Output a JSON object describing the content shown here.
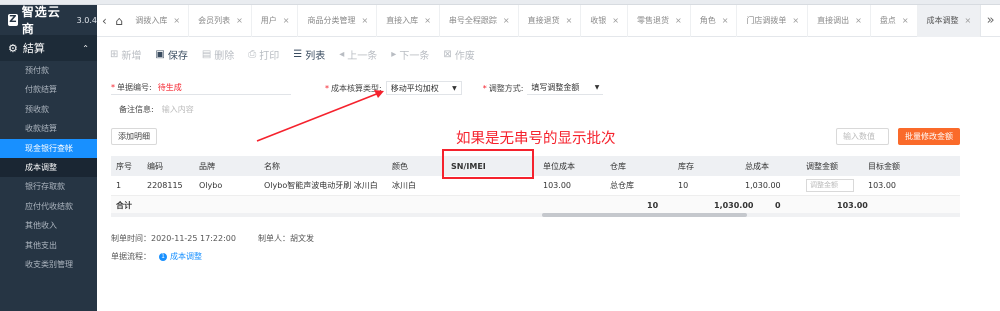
{
  "app": {
    "name": "智选云商",
    "version": "3.0.4"
  },
  "sidebar": {
    "section": "結算",
    "items": [
      {
        "label": "预付款"
      },
      {
        "label": "付款结算"
      },
      {
        "label": "预收款"
      },
      {
        "label": "收款结算"
      },
      {
        "label": "现金银行查帐"
      },
      {
        "label": "成本调整"
      },
      {
        "label": "银行存取款"
      },
      {
        "label": "应付代收结款"
      },
      {
        "label": "其他收入"
      },
      {
        "label": "其他支出"
      },
      {
        "label": "收支类别管理"
      }
    ]
  },
  "tabs": [
    {
      "label": "调拨入库"
    },
    {
      "label": "会员列表"
    },
    {
      "label": "用户"
    },
    {
      "label": "商品分类管理"
    },
    {
      "label": "直接入库"
    },
    {
      "label": "串号全程跟踪"
    },
    {
      "label": "直接退货"
    },
    {
      "label": "收银"
    },
    {
      "label": "零售退货"
    },
    {
      "label": "角色"
    },
    {
      "label": "门店调拨单"
    },
    {
      "label": "直接调出"
    },
    {
      "label": "盘点"
    },
    {
      "label": "成本调整"
    }
  ],
  "toolbar": {
    "new": "新增",
    "save": "保存",
    "delete": "删除",
    "print": "打印",
    "list": "列表",
    "prev": "上一条",
    "next": "下一条",
    "void": "作废"
  },
  "form": {
    "doc_no_label": "单据编号:",
    "doc_no_value": "待生成",
    "cost_type_label": "成本核算类型:",
    "cost_type_value": "移动平均加权",
    "adjust_mode_label": "调整方式:",
    "adjust_mode_value": "填写调整金额",
    "remark_label": "备注信息:",
    "remark_placeholder": "输入内容"
  },
  "add_detail_button": "添加明细",
  "annotation": "如果是无串号的显示批次",
  "amount_input_placeholder": "输入数值",
  "batch_modify_button": "批量修改金额",
  "table": {
    "headers": [
      "序号",
      "编码",
      "品牌",
      "名称",
      "颜色",
      "SN/IMEI",
      "单位成本",
      "仓库",
      "库存",
      "总成本",
      "调整金额",
      "目标金额"
    ],
    "rows": [
      {
        "no": "1",
        "code": "2208115",
        "brand": "Olybo",
        "name": "Olybo智能声波电动牙刷 冰川白",
        "color": "冰川白",
        "sn": "",
        "unit_cost": "103.00",
        "warehouse": "总仓库",
        "stock": "10",
        "total_cost": "1,030.00",
        "adjust_placeholder": "调整金额",
        "target": "103.00"
      }
    ],
    "footer": {
      "label": "合计",
      "stock": "10",
      "total_cost": "1,030.00",
      "adjust": "0",
      "target": "103.00"
    }
  },
  "meta": {
    "created_time": "制单时间：2020-11-25 17:22:00",
    "creator": "制单人：胡文发",
    "flow_label": "单据流程：",
    "flow_link": "成本调整"
  }
}
